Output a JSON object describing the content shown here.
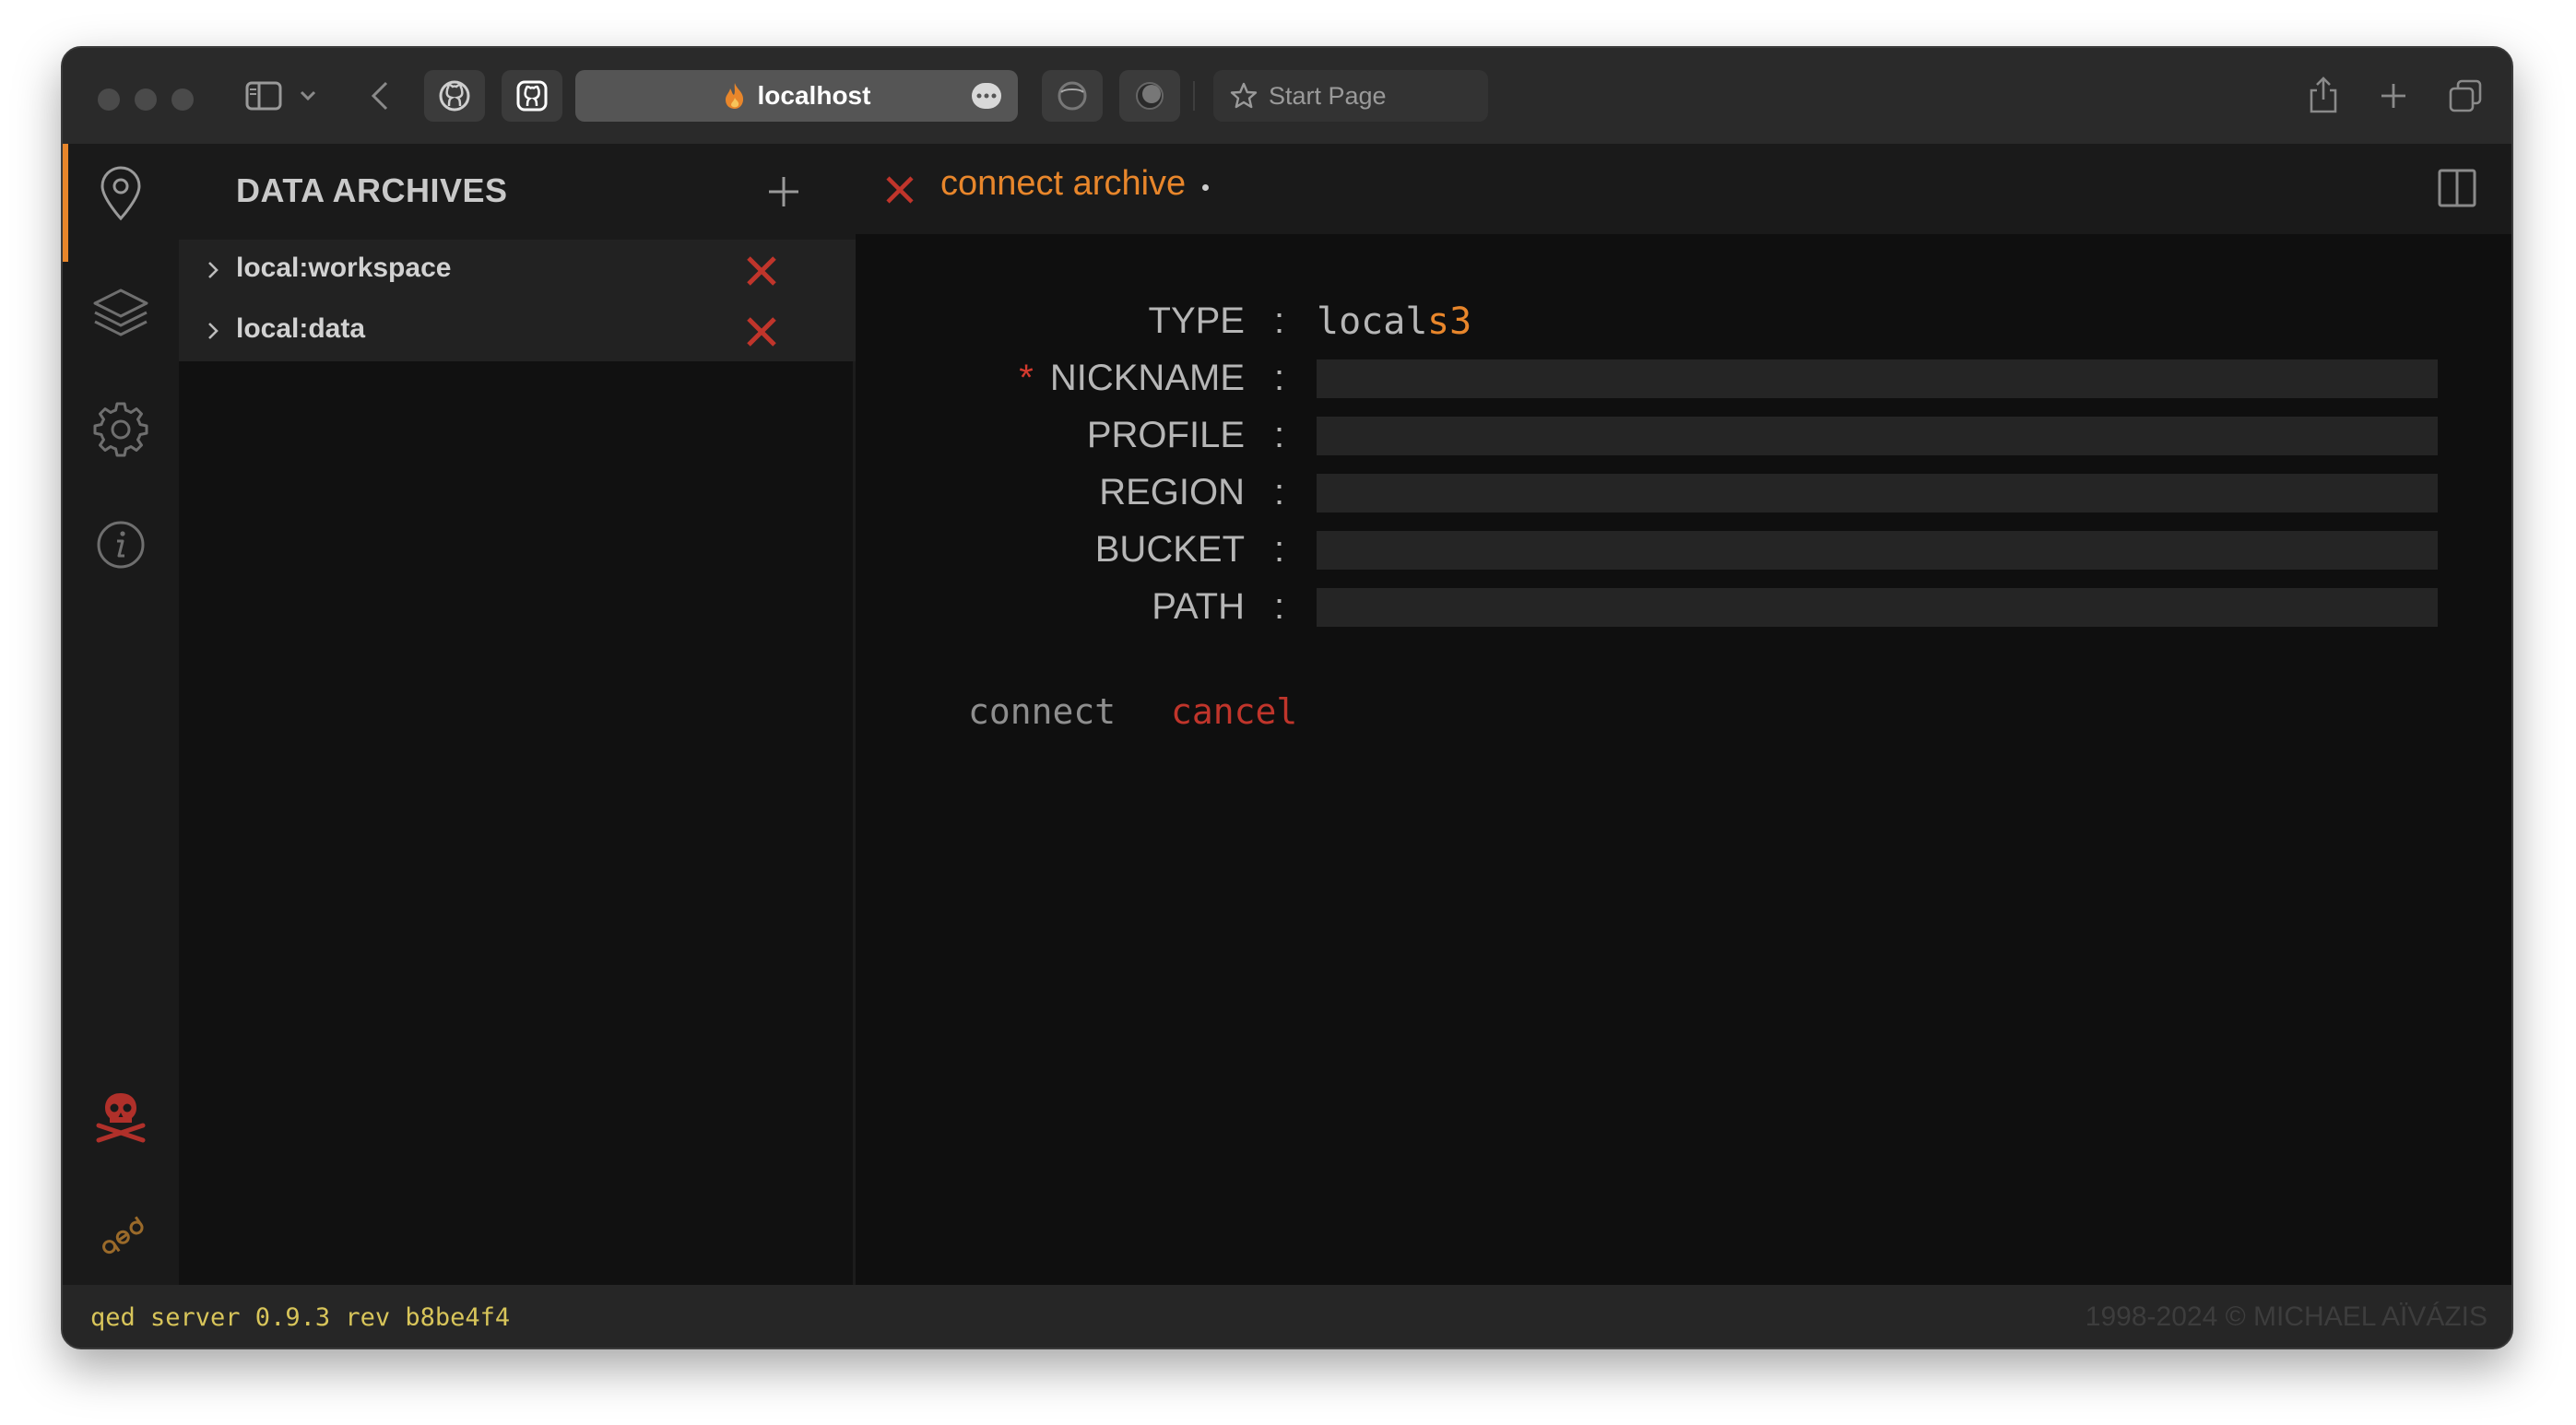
{
  "browser": {
    "url": "localhost",
    "start_page": "Start Page"
  },
  "explorer": {
    "title": "DATA ARCHIVES",
    "items": [
      {
        "label": "local:workspace"
      },
      {
        "label": "local:data"
      }
    ]
  },
  "editor": {
    "tab_title": "connect archive",
    "form": {
      "type_label": "TYPE",
      "type_options": [
        "local",
        "s3"
      ],
      "type_selected": "s3",
      "required_marker": "*",
      "colon": ":",
      "fields": [
        {
          "label": "NICKNAME",
          "value": "",
          "required": true
        },
        {
          "label": "PROFILE",
          "value": ""
        },
        {
          "label": "REGION",
          "value": ""
        },
        {
          "label": "BUCKET",
          "value": ""
        },
        {
          "label": "PATH",
          "value": ""
        }
      ],
      "connect_label": "connect",
      "cancel_label": "cancel"
    }
  },
  "status": {
    "left": "qed server 0.9.3 rev b8be4f4",
    "right": "1998-2024 © MICHAEL AÏVÁZIS"
  },
  "colors": {
    "accent": "#e8862b",
    "danger": "#c0352b",
    "status_text": "#d8c55a",
    "background": "#111111"
  },
  "icons": {
    "activity": [
      "location-pin-icon",
      "layers-icon",
      "gear-icon",
      "info-icon",
      "skull-icon",
      "qed-logo-icon"
    ]
  }
}
